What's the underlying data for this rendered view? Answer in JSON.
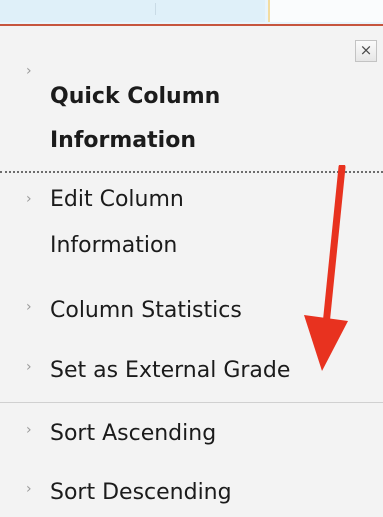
{
  "menu": {
    "close_icon": "×",
    "chevron": "›",
    "items": [
      {
        "label_line1": "Quick Column",
        "label_line2": "Information"
      },
      {
        "label_line1": "Edit Column",
        "label_line2": "Information"
      },
      {
        "label": "Column Statistics"
      },
      {
        "label": "Set as External Grade"
      },
      {
        "label": "Sort Ascending"
      },
      {
        "label": "Sort Descending"
      }
    ]
  },
  "annotation": {
    "arrow_color": "#e8321f",
    "arrow_icon": "arrow-down-icon"
  },
  "colors": {
    "top_rule": "#c6553e",
    "menu_background": "#f3f3f3"
  }
}
